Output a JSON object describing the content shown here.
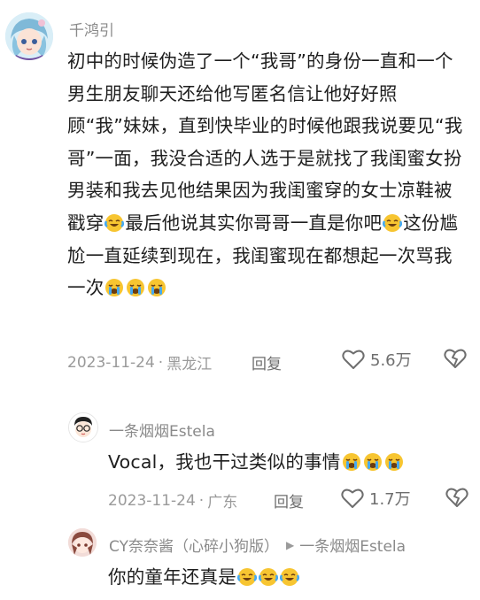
{
  "comment1": {
    "username": "千鸿引",
    "text_parts": [
      "初中的时候伪造了一个“我哥”的身份一直和一个男生朋友聊天还给他写匿名信让他好好照顾“我”妹妹，直到快毕业的时候他跟我说要见“我哥”一面，我没合适的人选于是就找了我闺蜜女扮男装和我去见他结果因为我闺蜜穿的女士凉鞋被戳穿",
      "最后他说其实你哥哥一直是你吧",
      "这份尴尬一直延续到现在，我闺蜜现在都想起一次骂我一次"
    ],
    "date": "2023-11-24",
    "location": "黑龙江",
    "reply_label": "回复",
    "likes": "5.6万"
  },
  "reply1": {
    "username": "一条烟烟Estela",
    "text": "Vocal，我也干过类似的事情",
    "date": "2023-11-24",
    "location": "广东",
    "reply_label": "回复",
    "likes": "1.7万"
  },
  "reply2": {
    "username": "CY奈奈酱（心碎小狗版）",
    "reply_to": "一条烟烟Estela",
    "text": "你的童年还真是"
  },
  "emojis": {
    "cry": "crying-face",
    "laugh": "laughing-crying-face"
  },
  "colors": {
    "text": "#1e1e1e",
    "meta": "#9a9a9a",
    "emoji_face": "#f7c531",
    "tear": "#45a9f2"
  }
}
